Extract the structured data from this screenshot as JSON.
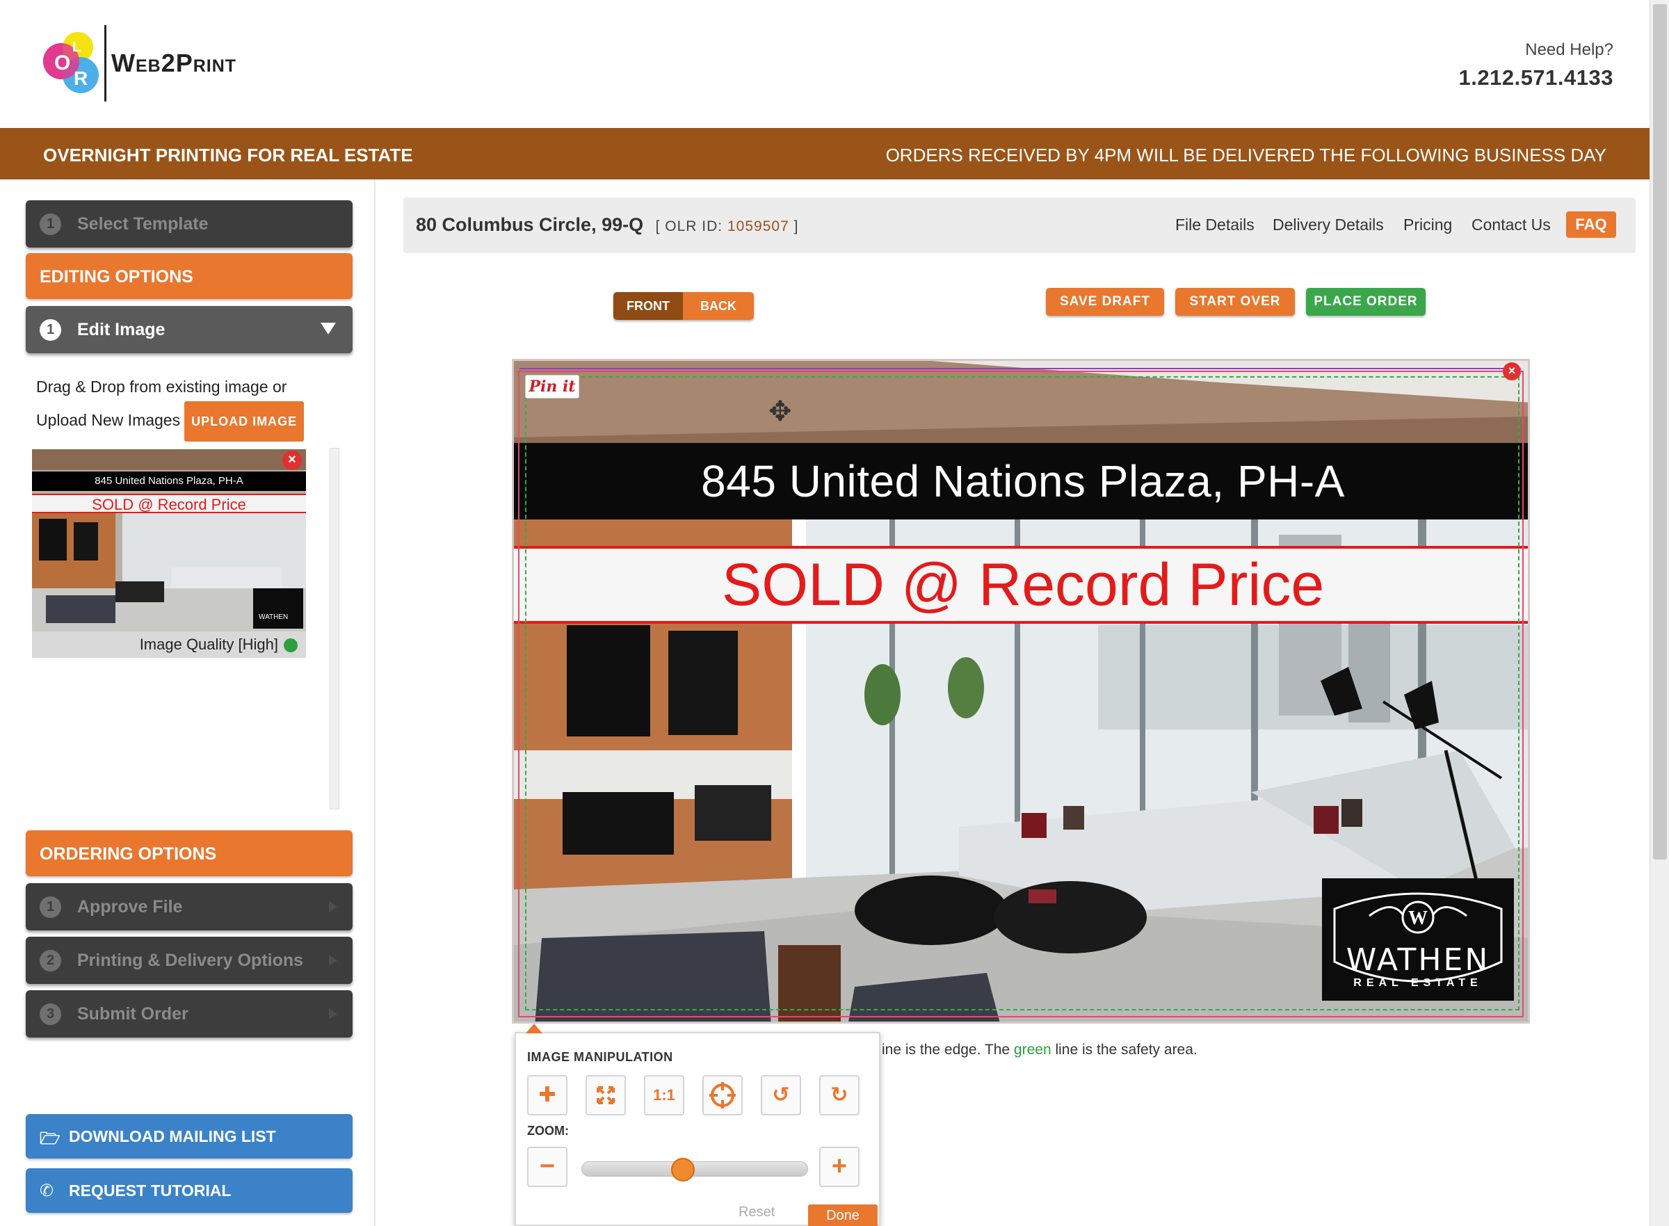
{
  "brand": {
    "name": "Web2Print"
  },
  "help": {
    "question": "Need Help?",
    "phone": "1.212.571.4133"
  },
  "band": {
    "left": "OVERNIGHT PRINTING FOR REAL ESTATE",
    "right": "ORDERS RECEIVED BY 4PM WILL BE DELIVERED THE FOLLOWING BUSINESS DAY"
  },
  "colors": {
    "brand_brown": "#9a5418",
    "accent_orange": "#e9772e",
    "action_green": "#3aa84a",
    "button_blue": "#3b82c8",
    "sold_red": "#e31b1b"
  },
  "sidebar": {
    "select_template": {
      "num": "1",
      "label": "Select Template"
    },
    "editing_options": "EDITING OPTIONS",
    "edit_image": {
      "num": "1",
      "label": "Edit Image"
    },
    "drag_text_1": "Drag & Drop from existing image or",
    "drag_text_2": "Upload New Images",
    "upload_button": "UPLOAD IMAGE",
    "thumbnail": {
      "title": "845 United Nations Plaza, PH-A",
      "subtitle": "SOLD @ Record Price",
      "logo": "WATHEN",
      "quality": "Image Quality [High]"
    },
    "ordering_options": "ORDERING OPTIONS",
    "approve_file": {
      "num": "1",
      "label": "Approve File"
    },
    "printing_delivery": {
      "num": "2",
      "label": "Printing & Delivery Options"
    },
    "submit_order": {
      "num": "3",
      "label": "Submit Order"
    },
    "download_button": "DOWNLOAD MAILING LIST",
    "tutorial_button": "REQUEST TUTORIAL"
  },
  "toolbar": {
    "address": "80 Columbus Circle, 99-Q",
    "olr_label": "[ OLR ID:",
    "olr_id": "1059507",
    "olr_close": "]",
    "links": [
      "File Details",
      "Delivery Details",
      "Pricing",
      "Contact Us"
    ],
    "faq": "FAQ"
  },
  "sides": {
    "front": "FRONT",
    "back": "BACK"
  },
  "actions": {
    "save_draft": "SAVE DRAFT",
    "start_over": "START OVER",
    "place_order": "PLACE ORDER"
  },
  "canvas": {
    "pin": "Pin it",
    "title": "845 United Nations Plaza, PH-A",
    "sold": "SOLD @ Record Price",
    "logo_name": "WATHEN",
    "logo_sub": "REAL ESTATE"
  },
  "note": {
    "pre": "ine is the edge. The ",
    "green": "green",
    "post": " line is the safety area."
  },
  "image_manipulation": {
    "title": "IMAGE MANIPULATION",
    "tools": [
      "move-icon",
      "fit-icon",
      "actual-size-icon",
      "center-icon",
      "rotate-left-icon",
      "rotate-right-icon"
    ],
    "actual_size_label": "1:1",
    "zoom_label": "ZOOM:",
    "zoom_level": 0.44,
    "reset": "Reset",
    "done": "Done"
  }
}
